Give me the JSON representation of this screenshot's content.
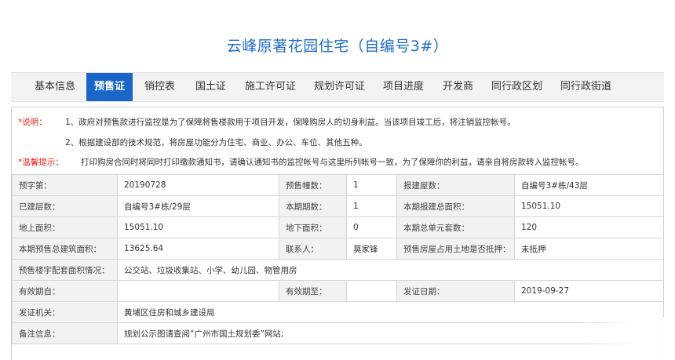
{
  "page": {
    "title": "云峰原著花园住宅（自编号3#）"
  },
  "tabs": [
    {
      "label": "基本信息"
    },
    {
      "label": "预售证"
    },
    {
      "label": "销控表"
    },
    {
      "label": "国土证"
    },
    {
      "label": "施工许可证"
    },
    {
      "label": "规划许可证"
    },
    {
      "label": "项目进度"
    },
    {
      "label": "开发商"
    },
    {
      "label": "同行政区划"
    },
    {
      "label": "同行政街道"
    }
  ],
  "active_tab": "预售证",
  "notes": {
    "star": "*",
    "explain_label": "说明：",
    "item1": "1、政府对预售款进行监控是为了保障将售楼款用于项目开发，保障购房人的切身利益。当该项目竣工后，将注销监控帐号。",
    "item2": "2、根据建设部的技术规范，将房屋功能分为住宅、商业、办公、车位、其他五种。",
    "tip_label": "温馨提示：",
    "tip_text": "打印购房合同时将同时打印缴款通知书，请确认通知书的监控帐号与这里所列帐号一致，为了保障你的利益，请亲自将房款转入监控帐号。"
  },
  "table": {
    "r1": {
      "l1": "预字第：",
      "v1": "20190728",
      "l2": "预售幢数：",
      "v2": "1",
      "l3": "报建屋数：",
      "v3": "自编号3#栋/43层"
    },
    "r2": {
      "l1": "已建层数：",
      "v1": "自编号3#栋/29层",
      "l2": "本期期数：",
      "v2": "1",
      "l3": "本期报建总面积：",
      "v3": "15051.10"
    },
    "r3": {
      "l1": "地上面积：",
      "v1": "15051.10",
      "l2": "地下面积：",
      "v2": "0",
      "l3": "本期总单元套数：",
      "v3": "120"
    },
    "r4": {
      "l1": "本期预售总建筑面积：",
      "v1": "13625.64",
      "l2": "联系人：",
      "v2": "莫家锋",
      "l3": "预售房屋占用土地是否抵押：",
      "v3": "未抵押"
    },
    "r5": {
      "l1": "预售楼宇配套面积情况：",
      "v1": "公交站、垃圾收集站、小学、幼儿园、物管用房"
    },
    "r6": {
      "l1": "有效期自：",
      "v1": "",
      "l2": "有效期至：",
      "v2": "",
      "l3": "发证日期：",
      "v3": "2019-09-27"
    },
    "r7": {
      "l1": "发证机关：",
      "v1": "黄埔区住房和城乡建设局"
    },
    "r8": {
      "l1": "备注信息：",
      "v1": "规划公示图请查阅“广州市国土规划委”网站;"
    }
  }
}
